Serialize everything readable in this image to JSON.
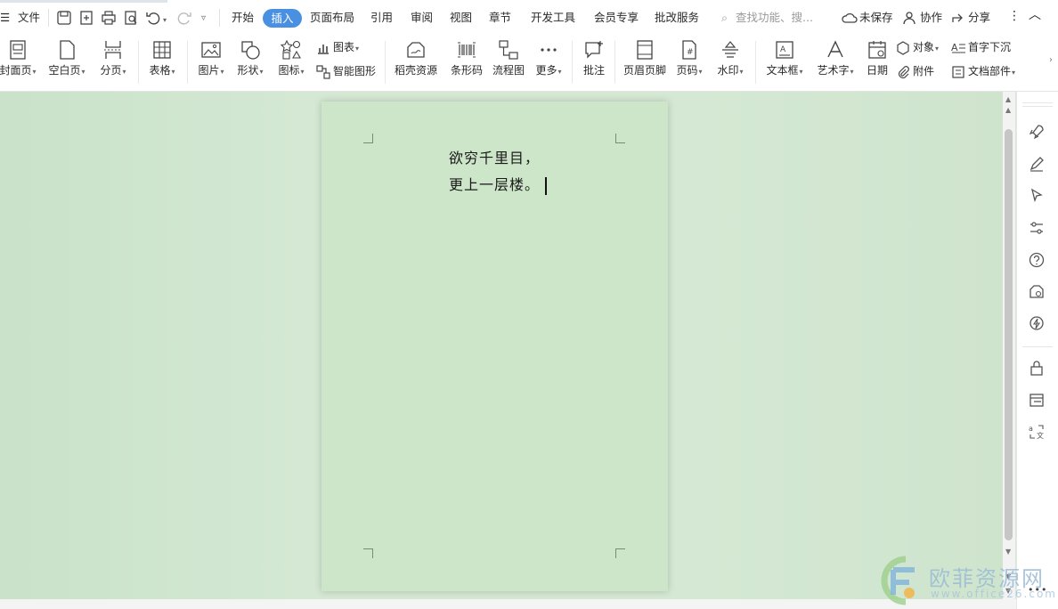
{
  "menubar": {
    "file_label": "文件",
    "tabs": [
      "开始",
      "插入",
      "页面布局",
      "引用",
      "审阅",
      "视图",
      "章节",
      "开发工具",
      "会员专享",
      "批改服务"
    ],
    "active_tab": "插入",
    "search_placeholder": "查找功能、搜...",
    "unsaved_label": "未保存",
    "collab_label": "协作",
    "share_label": "分享"
  },
  "ribbon": {
    "cover_page": "封面页",
    "blank_page": "空白页",
    "page_break": "分页",
    "table": "表格",
    "picture": "图片",
    "shape": "形状",
    "icon": "图标",
    "chart": "图表",
    "smart_graphic": "智能图形",
    "docer_resources": "稻壳资源",
    "barcode": "条形码",
    "flowchart": "流程图",
    "more": "更多",
    "comment": "批注",
    "header_footer": "页眉页脚",
    "page_number": "页码",
    "watermark": "水印",
    "text_box": "文本框",
    "word_art": "艺术字",
    "date": "日期",
    "object": "对象",
    "attachment": "附件",
    "drop_cap": "首字下沉",
    "doc_parts": "文档部件"
  },
  "document": {
    "line1": "欲穷千里目，",
    "line2": "更上一层楼。"
  },
  "watermark_logo": {
    "title": "欧菲资源网",
    "url": "www.office26.com"
  },
  "colors": {
    "accent": "#4a90e2",
    "page_bg": "#cde6c9",
    "workspace_bg": "#d4e8d3"
  }
}
